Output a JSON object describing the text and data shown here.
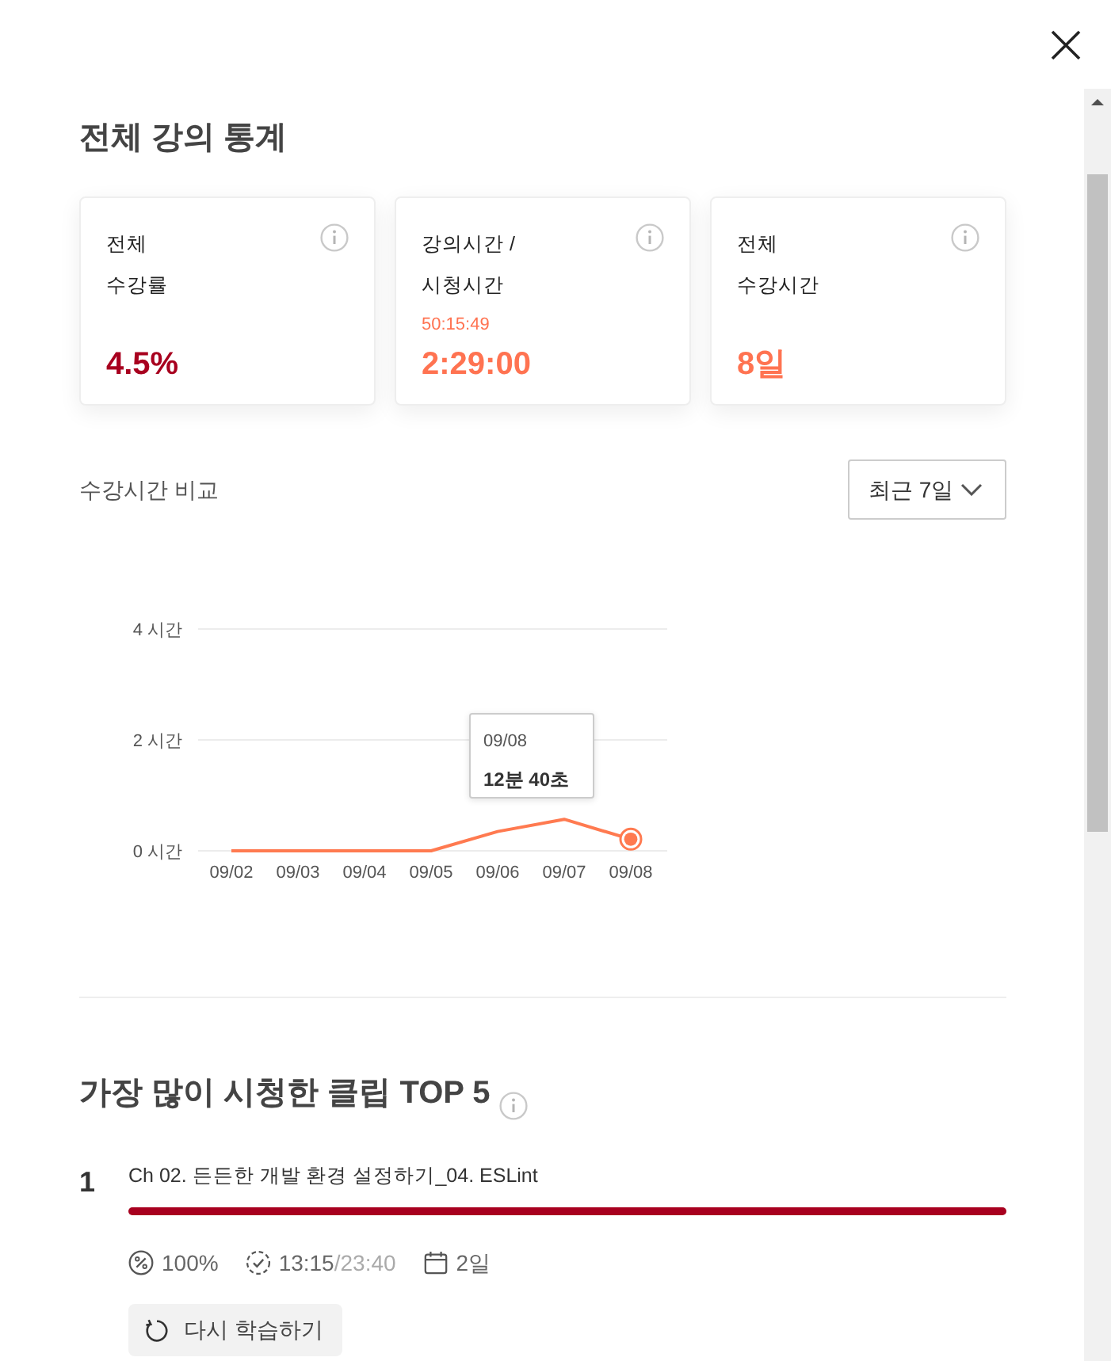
{
  "title": "전체 강의 통계",
  "stat_cards": [
    {
      "label": [
        "전체",
        "수강률"
      ],
      "value": "4.5%",
      "color": "#a8001f"
    },
    {
      "label": [
        "강의시간 /",
        "시청시간"
      ],
      "sub_value": "50:15:49",
      "value": "2:29:00",
      "color": "#ff7351"
    },
    {
      "label": [
        "전체",
        "수강시간"
      ],
      "value": "8일",
      "color": "#ff7351"
    }
  ],
  "comparison": {
    "title": "수강시간 비교",
    "period_select": {
      "value": "최근 7일"
    },
    "chart_data": {
      "type": "line",
      "categories": [
        "09/02",
        "09/03",
        "09/04",
        "09/05",
        "09/06",
        "09/07",
        "09/08"
      ],
      "series": [
        {
          "color": "#ff7a50",
          "values": [
            0,
            0,
            0,
            0,
            0.35,
            0.57,
            0.21
          ]
        }
      ],
      "ylim": [
        0,
        4
      ],
      "yticks": [
        {
          "value": 0,
          "label": "0 시간"
        },
        {
          "value": 2,
          "label": "2 시간"
        },
        {
          "value": 4,
          "label": "4 시간"
        }
      ]
    },
    "tooltip": {
      "date": "09/08",
      "value": "12분 40초"
    }
  },
  "top_clips": {
    "title": "가장 많이 시청한 클립 TOP 5",
    "items": [
      {
        "rank": "1",
        "title": "Ch 02. 든든한 개발 환경 설정하기_04. ESLint",
        "level": 1,
        "progress": "100%",
        "watched": "13:15",
        "duration": "/23:40",
        "days": "2일",
        "action": "다시 학습하기"
      }
    ]
  }
}
